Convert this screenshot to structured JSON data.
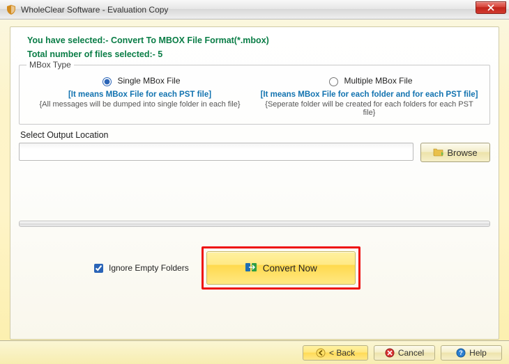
{
  "window": {
    "title": "WholeClear Software - Evaluation Copy"
  },
  "header": {
    "selected_info": "You have selected:- Convert To MBOX File Format(*.mbox)",
    "file_count_info": "Total number of files selected:- 5"
  },
  "mbox_type": {
    "legend": "MBox Type",
    "single": {
      "label": "Single MBox File",
      "desc_bold": "[It means MBox File for each PST file]",
      "desc_small": "{All messages will be dumped into single folder in each file}",
      "checked": true
    },
    "multiple": {
      "label": "Multiple MBox File",
      "desc_bold": "[It means MBox File for each folder and for each PST file]",
      "desc_small": "{Seperate folder will be created for each folders for each PST file}",
      "checked": false
    }
  },
  "output": {
    "label": "Select Output Location",
    "value": "",
    "browse_label": "Browse"
  },
  "options": {
    "ignore_empty_label": "Ignore Empty Folders",
    "ignore_empty_checked": true
  },
  "actions": {
    "convert_label": "Convert Now"
  },
  "wizard": {
    "back": "< Back",
    "cancel": "Cancel",
    "help": "Help"
  }
}
